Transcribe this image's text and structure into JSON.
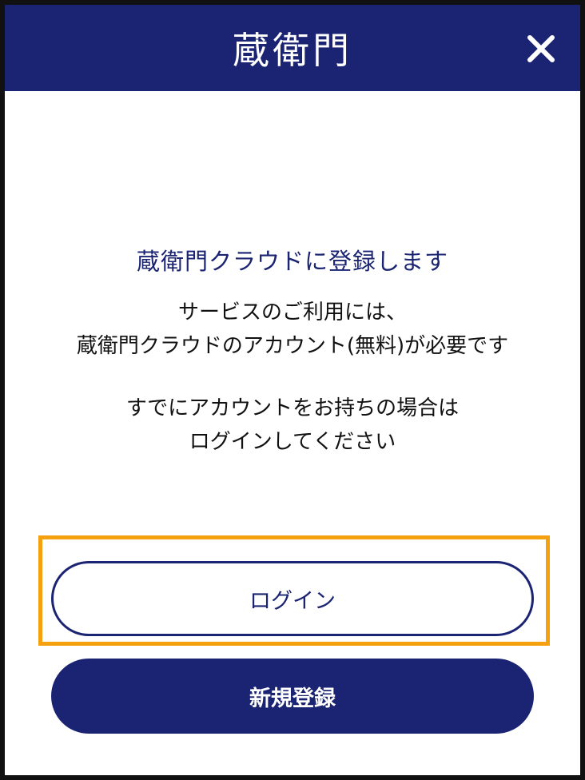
{
  "header": {
    "logo_text": "蔵衛門"
  },
  "dialog": {
    "heading": "蔵衛門クラウドに登録します",
    "message_line1": "サービスのご利用には、",
    "message_line2": "蔵衛門クラウドのアカウント(無料)が必要です",
    "message_line3": "すでにアカウントをお持ちの場合は",
    "message_line4": "ログインしてください"
  },
  "buttons": {
    "login_label": "ログイン",
    "register_label": "新規登録"
  },
  "colors": {
    "brand_navy": "#1a2472",
    "highlight_orange": "#f5a00e",
    "background": "#ffffff"
  },
  "icons": {
    "close": "close-icon"
  }
}
